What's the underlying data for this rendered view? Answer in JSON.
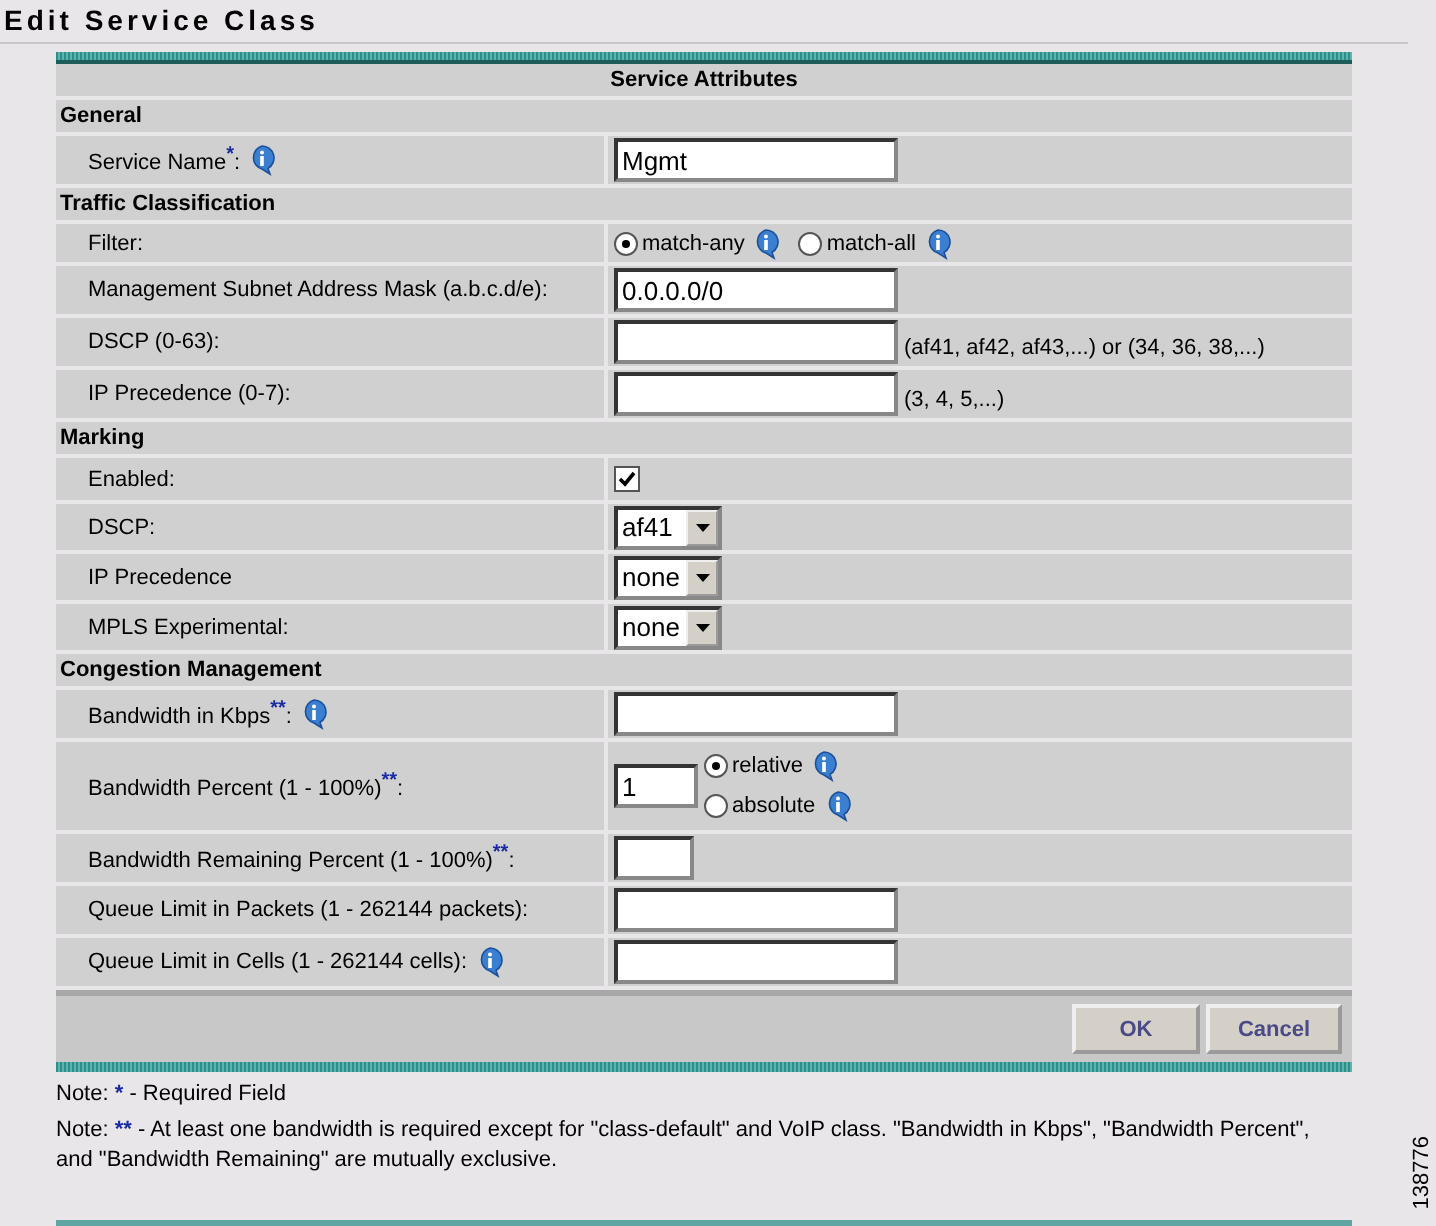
{
  "title": "Edit Service Class",
  "table": {
    "header": "Service Attributes",
    "sections": [
      {
        "title": "General",
        "rows": [
          {
            "kind": "text",
            "label": "Service Name",
            "marker": "*",
            "tail": ":",
            "info": true,
            "value": "Mgmt"
          }
        ]
      },
      {
        "title": "Traffic Classification",
        "rows": [
          {
            "kind": "radio",
            "label": "Filter:",
            "options": [
              {
                "label": "match-any",
                "selected": true,
                "info": true
              },
              {
                "label": "match-all",
                "selected": false,
                "info": true
              }
            ]
          },
          {
            "kind": "text",
            "label": "Management Subnet Address Mask (a.b.c.d/e):",
            "value": "0.0.0.0/0"
          },
          {
            "kind": "text",
            "label": "DSCP (0-63):",
            "value": "",
            "hint": "(af41, af42, af43,...) or (34, 36, 38,...)"
          },
          {
            "kind": "text",
            "label": "IP Precedence (0-7):",
            "value": "",
            "hint": "(3, 4, 5,...)"
          }
        ]
      },
      {
        "title": "Marking",
        "rows": [
          {
            "kind": "checkbox",
            "label": "Enabled:",
            "checked": true
          },
          {
            "kind": "select",
            "label": "DSCP:",
            "value": "af41"
          },
          {
            "kind": "select",
            "label": "IP Precedence",
            "value": "none"
          },
          {
            "kind": "select",
            "label": "MPLS Experimental:",
            "value": "none"
          }
        ]
      },
      {
        "title": "Congestion Management",
        "rows": [
          {
            "kind": "text",
            "label": "Bandwidth in Kbps",
            "marker": "**",
            "tail": ":",
            "info": true,
            "value": ""
          },
          {
            "kind": "percent",
            "label": "Bandwidth Percent (1  - 100%)",
            "marker": "**",
            "tail": ":",
            "value": "1",
            "options": [
              {
                "label": "relative",
                "selected": true,
                "info": true
              },
              {
                "label": "absolute",
                "selected": false,
                "info": true
              }
            ]
          },
          {
            "kind": "small",
            "label": "Bandwidth Remaining Percent (1  - 100%)",
            "marker": "**",
            "tail": ":",
            "value": ""
          },
          {
            "kind": "text",
            "label": "Queue Limit in Packets (1  - 262144 packets):",
            "value": ""
          },
          {
            "kind": "text",
            "label": "Queue Limit in Cells (1  - 262144 cells):",
            "info": true,
            "value": ""
          }
        ]
      }
    ]
  },
  "buttons": [
    "OK",
    "Cancel"
  ],
  "notes": [
    {
      "prefix": "Note: ",
      "mark": "*",
      "text": " - Required Field"
    },
    {
      "prefix": "Note: ",
      "mark": "**",
      "text": " - At least one bandwidth is required except for \"class-default\" and VoIP class. \"Bandwidth in Kbps\", \"Bandwidth Percent\", and \"Bandwidth Remaining\" are mutually exclusive."
    }
  ],
  "figure_number": "138776"
}
